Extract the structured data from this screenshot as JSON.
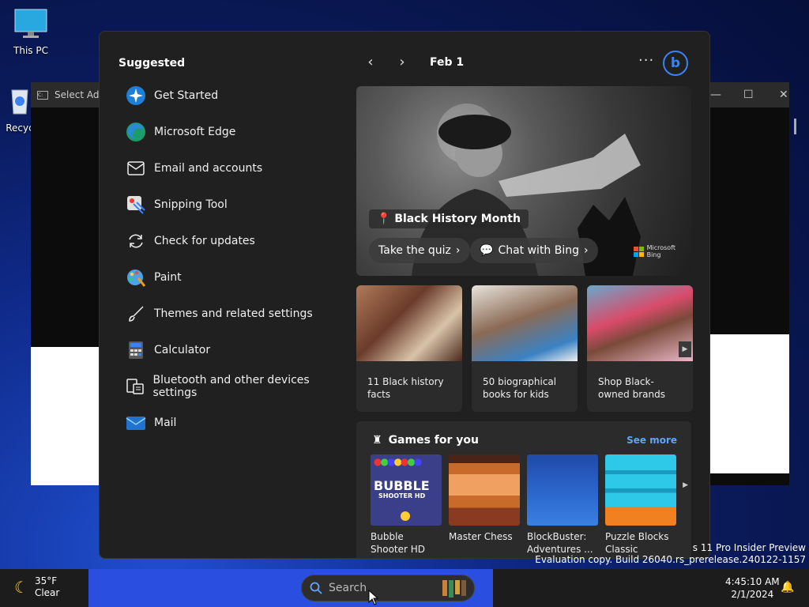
{
  "desktop": {
    "icons": [
      {
        "label": "This PC"
      },
      {
        "label": "Recyc"
      }
    ]
  },
  "console": {
    "title": "Select Adm"
  },
  "panel": {
    "suggested_title": "Suggested",
    "suggested_items": [
      {
        "label": "Get Started",
        "icon": "get-started-icon"
      },
      {
        "label": "Microsoft Edge",
        "icon": "edge-icon"
      },
      {
        "label": "Email and accounts",
        "icon": "mail-outline-icon"
      },
      {
        "label": "Snipping Tool",
        "icon": "snipping-tool-icon"
      },
      {
        "label": "Check for updates",
        "icon": "refresh-icon"
      },
      {
        "label": "Paint",
        "icon": "paint-icon"
      },
      {
        "label": "Themes and related settings",
        "icon": "brush-icon"
      },
      {
        "label": "Calculator",
        "icon": "calculator-icon"
      },
      {
        "label": "Bluetooth and other devices settings",
        "icon": "devices-icon"
      },
      {
        "label": "Mail",
        "icon": "mail-icon"
      }
    ],
    "date": "Feb 1",
    "more_label": "···",
    "hero": {
      "title": "Black History Month",
      "quiz_label": "Take the quiz",
      "chat_label": "Chat with Bing",
      "brand_line1": "Microsoft",
      "brand_line2": "Bing"
    },
    "cards": [
      {
        "title": "11 Black history facts"
      },
      {
        "title": "50 biographical books for kids"
      },
      {
        "title": "Shop Black-owned brands"
      }
    ],
    "games": {
      "title": "Games for you",
      "see_more": "See more",
      "tiles": [
        {
          "name": "Bubble Shooter HD",
          "art1": "BUBBLE",
          "art2": "SHOOTER HD"
        },
        {
          "name": "Master Chess"
        },
        {
          "name": "BlockBuster: Adventures ..."
        },
        {
          "name": "Puzzle Blocks Classic"
        }
      ]
    }
  },
  "watermark": {
    "line1": "s 11 Pro Insider Preview",
    "line2": "Evaluation copy. Build 26040.rs_prerelease.240122-1157"
  },
  "taskbar": {
    "weather_temp": "35°F",
    "weather_cond": "Clear",
    "search_placeholder": "Search",
    "time": "4:45:10 AM",
    "date": "2/1/2024"
  },
  "colors": {
    "accent": "#3b82f6",
    "link": "#60a5fa",
    "panel_bg": "#202020",
    "card_bg": "#2b2b2b"
  }
}
